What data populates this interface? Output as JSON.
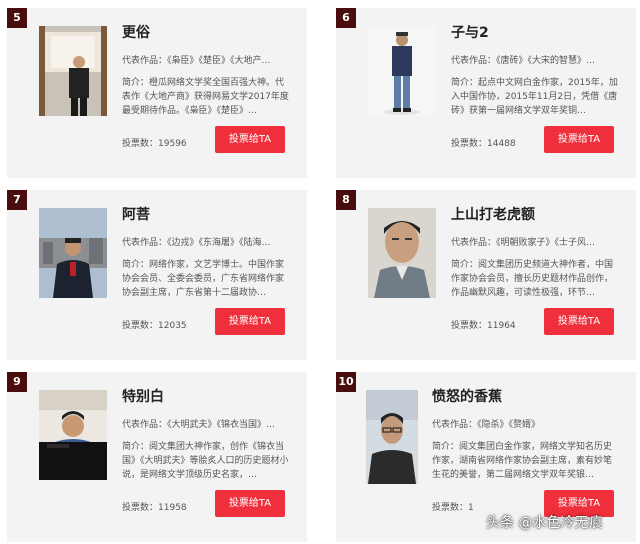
{
  "authors": [
    {
      "rank": "5",
      "name": "更俗",
      "works": "代表作品：《枭臣》《楚臣》《大地产…",
      "intro": "简介：橙瓜网络文学奖全国百强大神。代表作《大地产商》获得网易文学2017年度最受期待作品。《枭臣》《楚臣》…",
      "votes_label": "投票数：",
      "votes": "19596",
      "button": "投票给TA"
    },
    {
      "rank": "6",
      "name": "子与2",
      "works": "代表作品：《唐砖》《大宋的智慧》…",
      "intro": "简介：起点中文网白金作家，2015年，加入中国作协，2015年11月2日，凭借《唐砖》获第一届网络文学双年奖铜…",
      "votes_label": "投票数：",
      "votes": "14488",
      "button": "投票给TA"
    },
    {
      "rank": "7",
      "name": "阿菩",
      "works": "代表作品：《边戎》《东海屠》《陆海…",
      "intro": "简介：网络作家，文艺学博士。中国作家协会会员、全委会委员，广东省网络作家协会副主席，广东省第十二届政协…",
      "votes_label": "投票数：",
      "votes": "12035",
      "button": "投票给TA"
    },
    {
      "rank": "8",
      "name": "上山打老虎额",
      "works": "代表作品：《明朝败家子》《士子风…",
      "intro": "简介：阅文集团历史频道大神作者，中国作家协会会员，擅长历史题材作品创作，作品幽默风趣，可读性极强，环节…",
      "votes_label": "投票数：",
      "votes": "11964",
      "button": "投票给TA"
    },
    {
      "rank": "9",
      "name": "特别白",
      "works": "代表作品：《大明武夫》《锦衣当国》…",
      "intro": "简介：阅文集团大神作家，创作《锦衣当国》《大明武夫》等脍炙人口的历史题材小说，是网络文学顶级历史名家，…",
      "votes_label": "投票数：",
      "votes": "11958",
      "button": "投票给TA"
    },
    {
      "rank": "10",
      "name": "愤怒的香蕉",
      "works": "代表作品：《隐杀》《赘婿》",
      "intro": "简介：阅文集团白金作家，网络文学知名历史作家，湖南省网络作家协会副主席，素有妙笔生花的美誉，第二届网络文学双年奖银…",
      "votes_label": "投票数：",
      "votes": "1",
      "button": "投票给TA"
    }
  ],
  "watermark": "头条 @水色冷无痕",
  "colors": {
    "card_bg": "#f3f3f3",
    "rank_bg": "#4a0d0d",
    "button_bg": "#ef2f3c"
  }
}
